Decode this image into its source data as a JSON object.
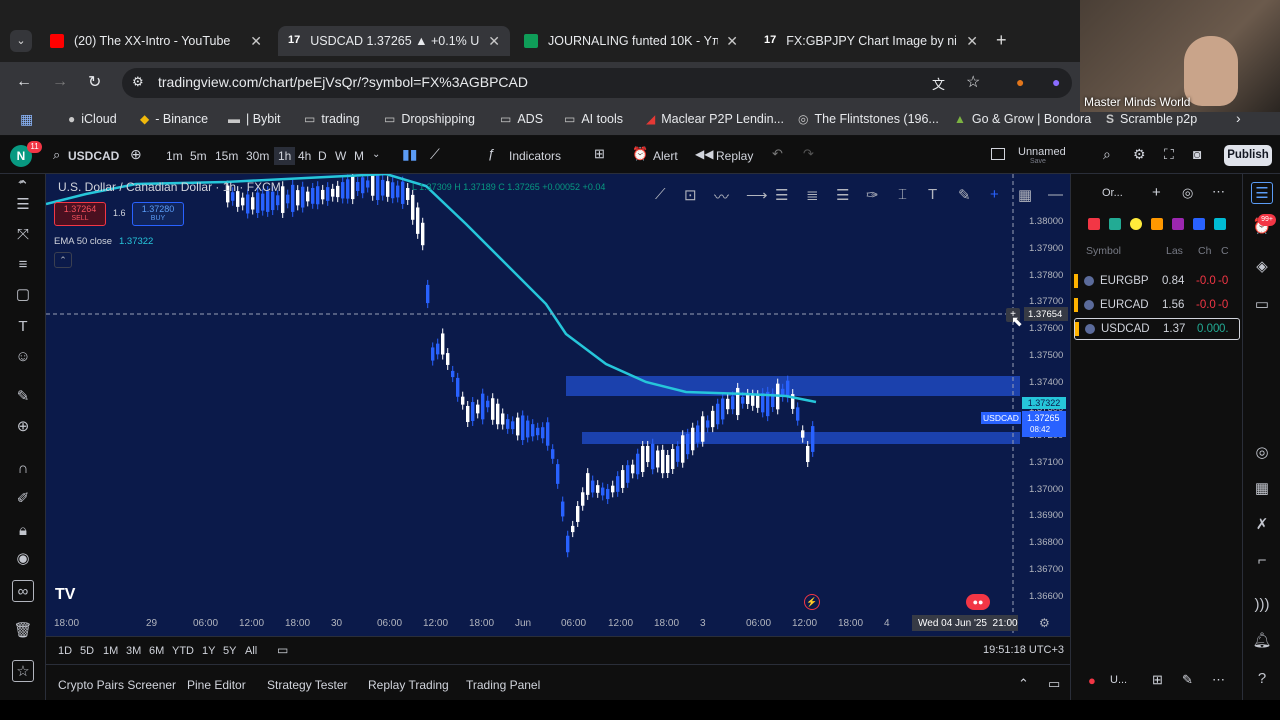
{
  "browser": {
    "tabs": [
      {
        "label": "(20) The XX-Intro - YouTube",
        "favicon_color": "#ff0000"
      },
      {
        "label": "USDCAD 1.37265 ▲ +0.1% Unr",
        "favicon_color": "#ffffff",
        "active": true
      },
      {
        "label": "JOURNALING funted 10K - Υπο",
        "favicon_color": "#0f9d58"
      },
      {
        "label": "FX:GBPJPY Chart Image by nikit",
        "favicon_color": "#ffffff"
      }
    ],
    "url": "tradingview.com/chart/peEjVsQr/?symbol=FX%3AGBPCAD",
    "bookmarks": [
      "iCloud",
      "- Binance",
      "| Bybit",
      "trading",
      "Dropshipping",
      "ADS",
      "AI tools",
      "Maclear P2P Lendin...",
      "The Flintstones (196...",
      "Go & Grow | Bondora",
      "Scramble p2p"
    ]
  },
  "webcam": {
    "label": "Master Minds World"
  },
  "toolbar": {
    "avatar_letter": "N",
    "avatar_badge": "11",
    "symbol": "USDCAD",
    "timeframes": [
      "1m",
      "5m",
      "15m",
      "30m",
      "1h",
      "4h",
      "D",
      "W",
      "M"
    ],
    "active_timeframe": "1h",
    "indicators": "Indicators",
    "alert": "Alert",
    "replay": "Replay",
    "layout_name": "Unnamed",
    "layout_sub": "Save",
    "publish": "Publish"
  },
  "legend": {
    "title": "U.S. Dollar / Canadian Dollar · 1h · FXCM",
    "ohlc": "L 1.37309 H 1.37189 C 1.37265 +0.00052 +0.04",
    "sell_price": "1.37264",
    "sell_label": "SELL",
    "spread": "1.6",
    "buy_price": "1.37280",
    "buy_label": "BUY",
    "ema_label": "EMA 50 close",
    "ema_value": "1.37322"
  },
  "price_axis": [
    "1.38000",
    "1.37900",
    "1.37800",
    "1.37700",
    "1.37600",
    "1.37500",
    "1.37400",
    "1.37300",
    "1.37200",
    "1.37100",
    "1.37000",
    "1.36900",
    "1.36800",
    "1.36700",
    "1.36600"
  ],
  "crosshair_price": "1.37654",
  "ema_tag": "1.37322",
  "last_price_tag": {
    "symbol": "USDCAD",
    "price": "1.37265",
    "countdown": "08:42"
  },
  "time_axis": [
    "18:00",
    "29",
    "06:00",
    "12:00",
    "18:00",
    "30",
    "06:00",
    "12:00",
    "18:00",
    "Jun",
    "06:00",
    "12:00",
    "18:00",
    "3",
    "06:00",
    "12:00",
    "18:00",
    "4",
    "06:00"
  ],
  "crosshair_time": "Wed 04 Jun '25  21:00",
  "ranges": [
    "1D",
    "5D",
    "1M",
    "3M",
    "6M",
    "YTD",
    "1Y",
    "5Y",
    "All"
  ],
  "clock": "19:51:18 UTC+3",
  "bottom_tabs": [
    "Crypto Pairs Screener",
    "Pine Editor",
    "Strategy Tester",
    "Replay Trading",
    "Trading Panel"
  ],
  "watchlist": {
    "header_title": "Or...",
    "columns": [
      "Symbol",
      "Las",
      "Ch",
      "C"
    ],
    "rows": [
      {
        "symbol": "EURGBP",
        "last": "0.84",
        "chg": "-0.0",
        "chgp": "-0"
      },
      {
        "symbol": "EURCAD",
        "last": "1.56",
        "chg": "-0.0",
        "chgp": "-0"
      },
      {
        "symbol": "USDCAD",
        "last": "1.37",
        "chg": "0.00",
        "chgp": "0."
      }
    ],
    "footer": "U..."
  },
  "colors": {
    "ema": "#26c6da",
    "zone": "#2962ff",
    "candle": "#ffffff",
    "candle_down": "#2962ff",
    "chart_bg": "#0b1a4a"
  }
}
